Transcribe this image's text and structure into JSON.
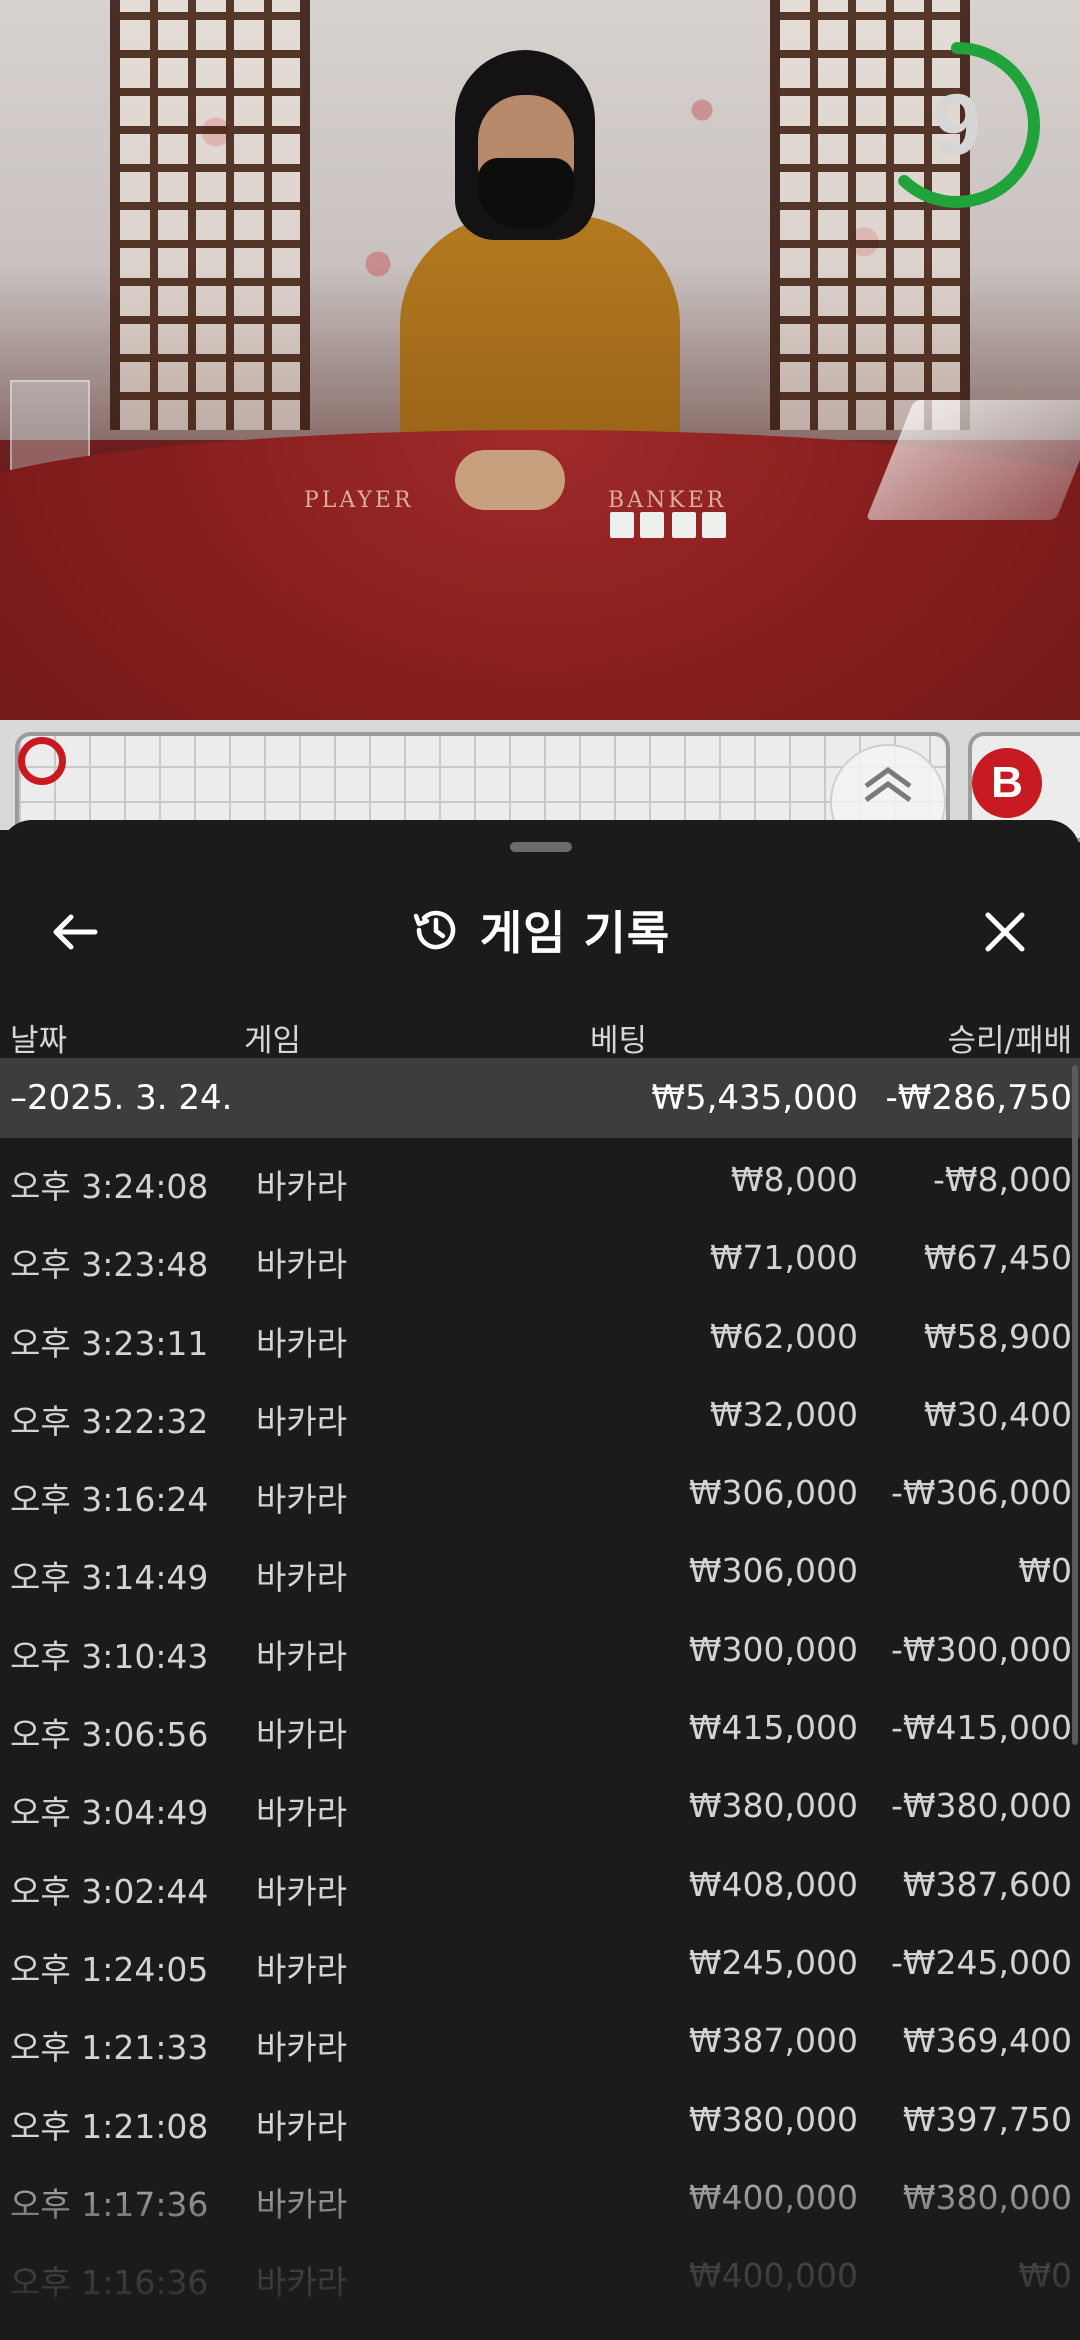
{
  "video": {
    "countdown": "9",
    "countdown_progress": 0.62,
    "table_player_label": "PLAYER",
    "table_banker_label": "BANKER",
    "timer_color": "#1fa33a"
  },
  "roadmap": {
    "banker_badge": "B",
    "banker_color": "#c81a22"
  },
  "header": {
    "title": "게임 기록",
    "back_icon": "arrow-left-icon",
    "history_icon": "history-icon",
    "close_icon": "close-icon"
  },
  "columns": {
    "date": "날짜",
    "game": "게임",
    "bet": "베팅",
    "result": "승리/패배"
  },
  "summary": {
    "date": "–2025. 3. 24.",
    "bet": "₩5,435,000",
    "result": "-₩286,750"
  },
  "records": [
    {
      "time": "오후 3:24:08",
      "game": "바카라",
      "bet": "₩8,000",
      "result": "-₩8,000"
    },
    {
      "time": "오후 3:23:48",
      "game": "바카라",
      "bet": "₩71,000",
      "result": "₩67,450"
    },
    {
      "time": "오후 3:23:11",
      "game": "바카라",
      "bet": "₩62,000",
      "result": "₩58,900"
    },
    {
      "time": "오후 3:22:32",
      "game": "바카라",
      "bet": "₩32,000",
      "result": "₩30,400"
    },
    {
      "time": "오후 3:16:24",
      "game": "바카라",
      "bet": "₩306,000",
      "result": "-₩306,000"
    },
    {
      "time": "오후 3:14:49",
      "game": "바카라",
      "bet": "₩306,000",
      "result": "₩0"
    },
    {
      "time": "오후 3:10:43",
      "game": "바카라",
      "bet": "₩300,000",
      "result": "-₩300,000"
    },
    {
      "time": "오후 3:06:56",
      "game": "바카라",
      "bet": "₩415,000",
      "result": "-₩415,000"
    },
    {
      "time": "오후 3:04:49",
      "game": "바카라",
      "bet": "₩380,000",
      "result": "-₩380,000"
    },
    {
      "time": "오후 3:02:44",
      "game": "바카라",
      "bet": "₩408,000",
      "result": "₩387,600"
    },
    {
      "time": "오후 1:24:05",
      "game": "바카라",
      "bet": "₩245,000",
      "result": "-₩245,000"
    },
    {
      "time": "오후 1:21:33",
      "game": "바카라",
      "bet": "₩387,000",
      "result": "₩369,400"
    },
    {
      "time": "오후 1:21:08",
      "game": "바카라",
      "bet": "₩380,000",
      "result": "₩397,750"
    },
    {
      "time": "오후 1:17:36",
      "game": "바카라",
      "bet": "₩400,000",
      "result": "₩380,000"
    },
    {
      "time": "오후 1:16:36",
      "game": "바카라",
      "bet": "₩400,000",
      "result": "₩0"
    }
  ]
}
